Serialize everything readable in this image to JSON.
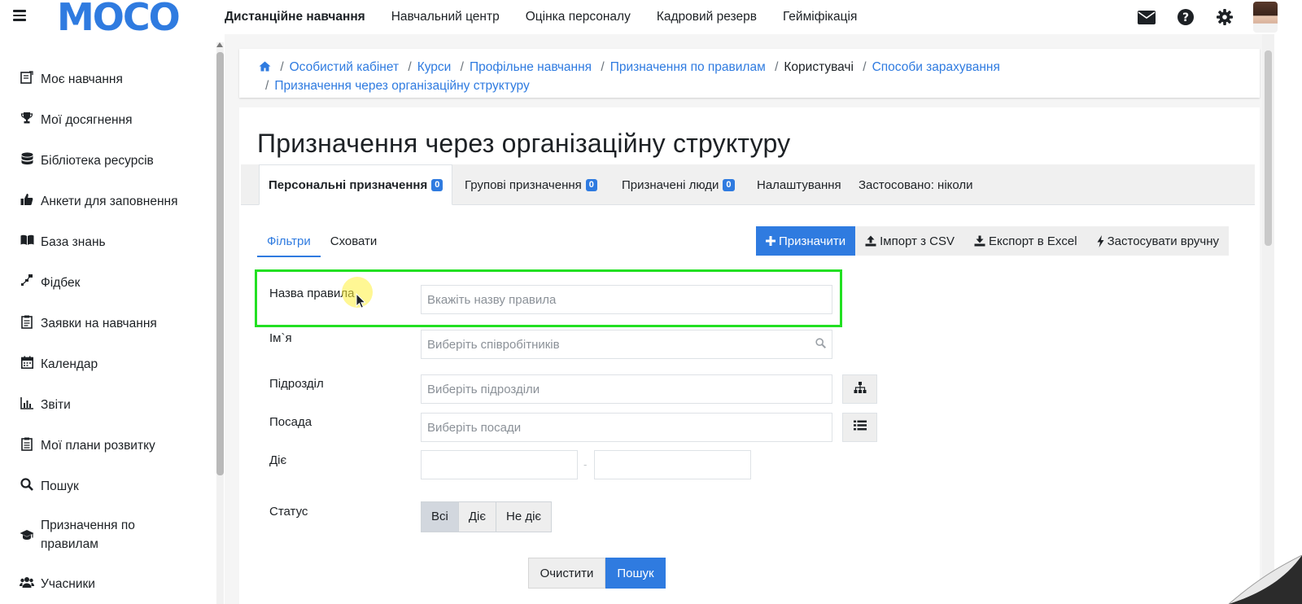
{
  "app": {
    "logo": "MOCO"
  },
  "topnav": {
    "items": [
      {
        "label": "Дистанційне навчання",
        "active": true
      },
      {
        "label": "Навчальний центр"
      },
      {
        "label": "Оцінка персоналу"
      },
      {
        "label": "Кадровий резерв"
      },
      {
        "label": "Гейміфікація"
      }
    ],
    "icons": [
      "envelope-icon",
      "question-circle-icon",
      "gear-icon",
      "user-avatar"
    ]
  },
  "sidebar": {
    "items": [
      {
        "label": "Моє навчання",
        "icon": "book-icon"
      },
      {
        "label": "Мої досягнення",
        "icon": "trophy-icon"
      },
      {
        "label": "Бібліотека ресурсів",
        "icon": "database-icon"
      },
      {
        "label": "Анкети для заповнення",
        "icon": "thumbs-up-icon"
      },
      {
        "label": "База знань",
        "icon": "open-book-icon"
      },
      {
        "label": "Фідбек",
        "icon": "feedback-icon"
      },
      {
        "label": "Заявки на навчання",
        "icon": "clipboard-icon"
      },
      {
        "label": "Календар",
        "icon": "calendar-icon"
      },
      {
        "label": "Звіти",
        "icon": "chart-icon"
      },
      {
        "label": "Мої плани розвитку",
        "icon": "clipboard-list-icon"
      },
      {
        "label": "Пошук",
        "icon": "search-icon"
      },
      {
        "label": "Призначення по правилам",
        "icon": "graduation-cap-icon"
      },
      {
        "label": "Учасники",
        "icon": "users-icon"
      }
    ]
  },
  "breadcrumb": {
    "items": [
      {
        "label": "Особистий кабінет",
        "link": true
      },
      {
        "label": "Курси",
        "link": true
      },
      {
        "label": "Профільне навчання",
        "link": true
      },
      {
        "label": "Призначення по правилам",
        "link": true
      },
      {
        "label": "Користувачі",
        "link": false
      },
      {
        "label": "Способи зарахування",
        "link": true
      },
      {
        "label": "Призначення через організаційну структуру",
        "link": true
      }
    ]
  },
  "page": {
    "title": "Призначення через організаційну структуру"
  },
  "tabs": [
    {
      "label": "Персональні призначення",
      "badge": "0",
      "active": true
    },
    {
      "label": "Групові призначення",
      "badge": "0"
    },
    {
      "label": "Призначені люди",
      "badge": "0"
    },
    {
      "label": "Налаштування"
    },
    {
      "label": "Застосовано: ніколи"
    }
  ],
  "subtabs": [
    {
      "label": "Фільтри",
      "active": true
    },
    {
      "label": "Сховати"
    }
  ],
  "toolbar": {
    "assign": "Призначити",
    "import_csv": "Імпорт з CSV",
    "export_excel": "Експорт в Excel",
    "apply_manually": "Застосувати вручну"
  },
  "filters": {
    "rule_name": {
      "label": "Назва правила",
      "placeholder": "Вкажіть назву правила"
    },
    "name": {
      "label": "Ім`я",
      "placeholder": "Виберіть співробітників"
    },
    "department": {
      "label": "Підрозділ",
      "placeholder": "Виберіть підрозділи"
    },
    "position": {
      "label": "Посада",
      "placeholder": "Виберіть посади"
    },
    "active": {
      "label": "Діє",
      "separator": "-"
    },
    "status": {
      "label": "Статус",
      "options": [
        "Всі",
        "Діє",
        "Не діє"
      ],
      "selected": "Всі"
    }
  },
  "actions": {
    "clear": "Очистити",
    "search": "Пошук"
  },
  "colors": {
    "accent": "#2f7be0",
    "highlight": "#22e022"
  }
}
